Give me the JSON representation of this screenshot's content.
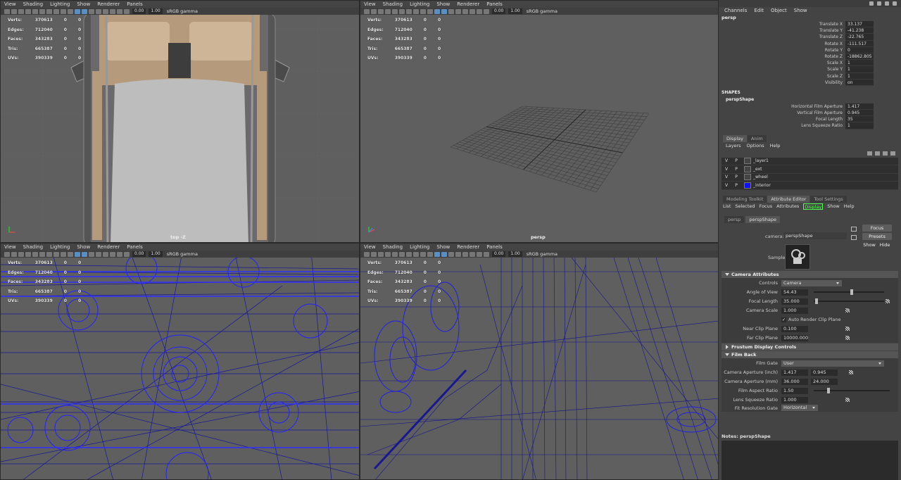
{
  "viewport_menu": [
    "View",
    "Shading",
    "Lighting",
    "Show",
    "Renderer",
    "Panels"
  ],
  "viewport_toolbar": {
    "value1": "0.00",
    "value2": "1.00",
    "color_space": "sRGB gamma"
  },
  "stats_tl": [
    [
      "Verts:",
      "370613",
      "0",
      "0"
    ],
    [
      "Edges:",
      "712040",
      "0",
      "0"
    ],
    [
      "Faces:",
      "343283",
      "0",
      "0"
    ],
    [
      "Tris:",
      "665387",
      "0",
      "0"
    ],
    [
      "UVs:",
      "390339",
      "0",
      "0"
    ]
  ],
  "viewports": {
    "top_left_label": "top -Z",
    "top_right_label": "persp"
  },
  "channel_box": {
    "menu": [
      "Channels",
      "Edit",
      "Object",
      "Show"
    ],
    "object": "persp",
    "attrs": [
      [
        "Translate X",
        "33.137"
      ],
      [
        "Translate Y",
        "-41.238"
      ],
      [
        "Translate Z",
        "-22.765"
      ],
      [
        "Rotate X",
        "-111.517"
      ],
      [
        "Rotate Y",
        "0"
      ],
      [
        "Rotate Z",
        "-18862.805"
      ],
      [
        "Scale X",
        "1"
      ],
      [
        "Scale Y",
        "1"
      ],
      [
        "Scale Z",
        "1"
      ],
      [
        "Visibility",
        "on"
      ]
    ],
    "shapes_header": "SHAPES",
    "shape_name": "perspShape",
    "shape_attrs": [
      [
        "Horizontal Film Aperture",
        "1.417"
      ],
      [
        "Vertical Film Aperture",
        "0.945"
      ],
      [
        "Focal Length",
        "35"
      ],
      [
        "Lens Squeeze Ratio",
        "1"
      ]
    ]
  },
  "layer_editor": {
    "tabs": [
      "Display",
      "Anim"
    ],
    "menu": [
      "Layers",
      "Options",
      "Help"
    ],
    "layers": [
      {
        "v": "V",
        "p": "P",
        "name": "_layer1",
        "color": "#444444"
      },
      {
        "v": "V",
        "p": "P",
        "name": "_ext",
        "color": "#444444"
      },
      {
        "v": "V",
        "p": "P",
        "name": "_wheel",
        "color": "#444444"
      },
      {
        "v": "V",
        "p": "P",
        "name": "_interior",
        "color": "#1010ff"
      }
    ]
  },
  "attribute_editor": {
    "panel_tabs": [
      "Modeling Toolkit",
      "Attribute Editor",
      "Tool Settings"
    ],
    "menu": [
      "List",
      "Selected",
      "Focus",
      "Attributes",
      "Display",
      "Show",
      "Help"
    ],
    "node_tabs": [
      "persp",
      "perspShape"
    ],
    "camera_label": "camera:",
    "camera_value": "perspShape",
    "buttons": {
      "focus": "Focus",
      "presets": "Presets",
      "show": "Show",
      "hide": "Hide"
    },
    "sample_label": "Sample",
    "camera_attributes": {
      "title": "Camera Attributes",
      "controls_label": "Controls",
      "controls_value": "Camera",
      "rows": [
        {
          "label": "Angle of View",
          "value": "54.43",
          "slider": 0.54
        },
        {
          "label": "Focal Length",
          "value": "35.000",
          "slider": 0.02
        },
        {
          "label": "Camera Scale",
          "value": "1.000"
        }
      ],
      "auto_render_clip": "Auto Render Clip Plane",
      "near_label": "Near Clip Plane",
      "near_value": "0.100",
      "far_label": "Far Clip Plane",
      "far_value": "10000.000"
    },
    "frustum_title": "Frustum Display Controls",
    "film_back": {
      "title": "Film Back",
      "gate_label": "Film Gate",
      "gate_value": "User",
      "aperture_inch_label": "Camera Aperture (inch)",
      "aperture_inch": [
        "1.417",
        "0.945"
      ],
      "aperture_mm_label": "Camera Aperture (mm)",
      "aperture_mm": [
        "36.000",
        "24.000"
      ],
      "aspect_label": "Film Aspect Ratio",
      "aspect_value": "1.50",
      "aspect_slider": 0.18,
      "squeeze_label": "Lens Squeeze Ratio",
      "squeeze_value": "1.000",
      "fit_label": "Fit Resolution Gate",
      "fit_value": "Horizontal"
    },
    "notes_label": "Notes: perspShape"
  },
  "colors": {
    "wire": "#1a1aa8",
    "wire_bright": "#2222ff",
    "grid": "#777777"
  }
}
